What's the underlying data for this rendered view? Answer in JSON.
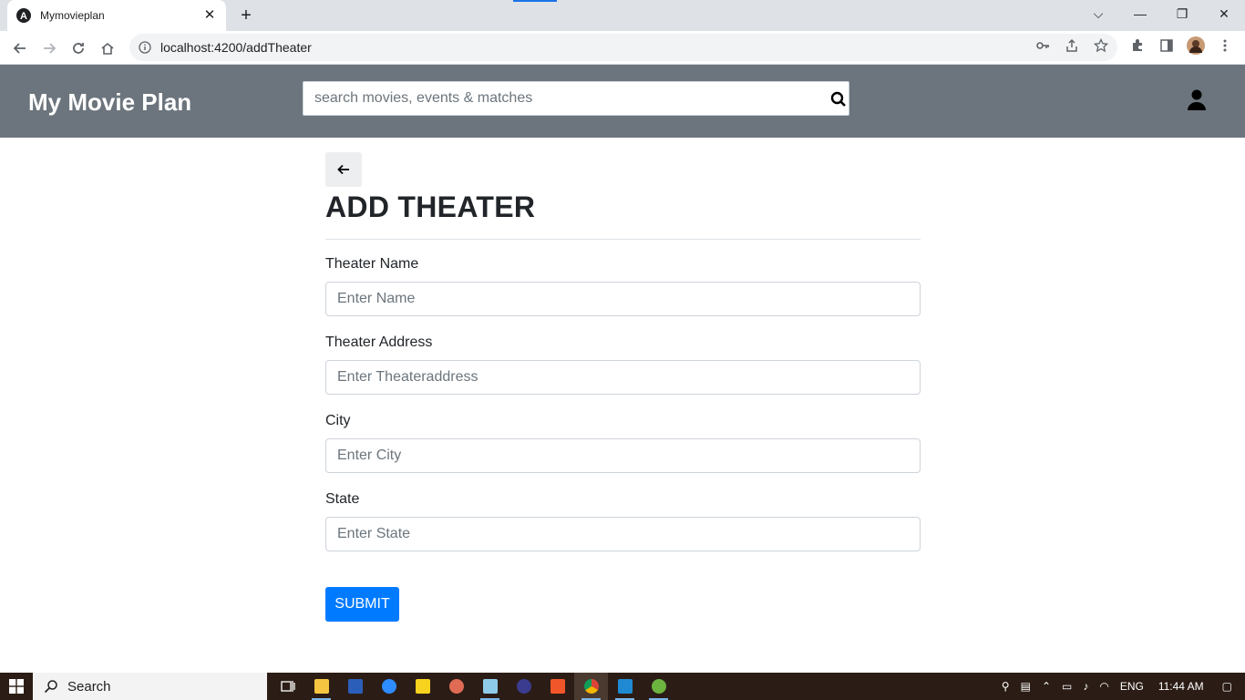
{
  "browser": {
    "tab_title": "Mymovieplan",
    "url": "localhost:4200/addTheater"
  },
  "app": {
    "brand": "My Movie Plan",
    "search_placeholder": "search movies, events & matches"
  },
  "form": {
    "title": "ADD THEATER",
    "fields": [
      {
        "label": "Theater Name",
        "placeholder": "Enter Name"
      },
      {
        "label": "Theater Address",
        "placeholder": "Enter Theateraddress"
      },
      {
        "label": "City",
        "placeholder": "Enter City"
      },
      {
        "label": "State",
        "placeholder": "Enter State"
      }
    ],
    "submit_label": "SUBMIT"
  },
  "taskbar": {
    "search_label": "Search",
    "language": "ENG",
    "time": "11:44 AM"
  },
  "colors": {
    "header_bg": "#6c757d",
    "primary": "#007bff"
  }
}
